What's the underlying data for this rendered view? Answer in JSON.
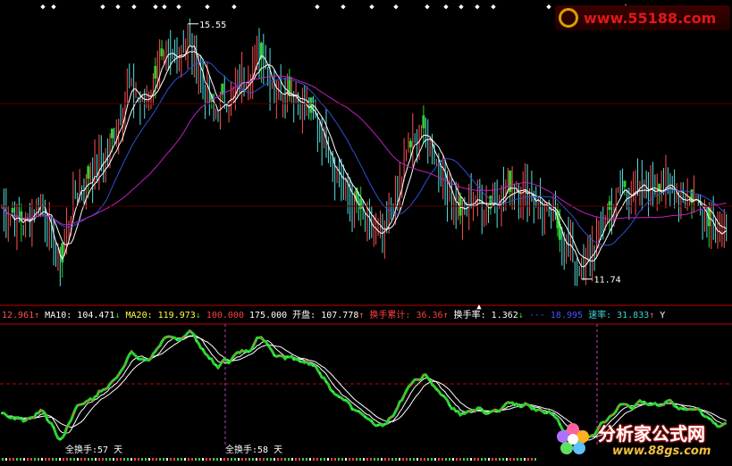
{
  "colors": {
    "background": "#000000",
    "up": "#ff5050",
    "down": "#55e0e0",
    "ma_short": "#ffffff",
    "ma10": "#ffff40",
    "ma20": "#ff40ff",
    "ma_blue": "#3050d0",
    "ma_magenta": "#c020c0",
    "highlight_green": "#30d030",
    "divider": "#c00000",
    "label_white": "#ffffff",
    "label_red": "#ff4040",
    "label_green": "#40c040",
    "label_blue": "#5050ff",
    "label_cyan": "#40d0d0"
  },
  "info_bar": [
    {
      "text": "12.961",
      "color": "#ff5050"
    },
    {
      "text": "↑",
      "color": "#ff5050"
    },
    {
      "text": " MA10: 104.471",
      "color": "#ffffff"
    },
    {
      "text": "↓",
      "color": "#40c040"
    },
    {
      "text": " MA20: 119.973",
      "color": "#ffff40"
    },
    {
      "text": "↓",
      "color": "#40c040"
    },
    {
      "text": " 100.000",
      "color": "#ff4040"
    },
    {
      "text": "  175.000",
      "color": "#ffffff"
    },
    {
      "text": "  开盘: 107.778",
      "color": "#ffffff"
    },
    {
      "text": "↑",
      "color": "#ff5050"
    },
    {
      "text": "  换手累计: 36.36",
      "color": "#ff4040"
    },
    {
      "text": "↑",
      "color": "#ff5050"
    },
    {
      "text": "  换手率: 1.362",
      "color": "#ffffff"
    },
    {
      "text": "↓",
      "color": "#40c040"
    },
    {
      "text": "  ···  18.995",
      "color": "#5050ff"
    },
    {
      "text": "  速率: 31.833",
      "color": "#40d0d0"
    },
    {
      "text": "↑",
      "color": "#ff5050"
    },
    {
      "text": " Y",
      "color": "#ffffff"
    }
  ],
  "annotations": {
    "high_label": "15.55",
    "low_label": "11.74",
    "turnover_1": "全换手:57 天",
    "turnover_2": "全换手:58 天"
  },
  "watermarks": {
    "top_url": "www.55188.com",
    "bottom_cn": "分析家公式网",
    "bottom_url": "www.88gs.com"
  },
  "chart_data": [
    {
      "type": "candlestick",
      "title": "",
      "price_high": 15.55,
      "price_low": 11.74,
      "ylim": [
        11.4,
        15.8
      ],
      "high_index": 86,
      "low_index": 268,
      "ma_series": [
        {
          "name": "",
          "color": "#ffffff",
          "period": 5
        },
        {
          "name": "",
          "color": "#ffffff",
          "period": 10
        },
        {
          "name": "",
          "color": "#3050d0",
          "period": 25
        },
        {
          "name": "",
          "color": "#c020c0",
          "period": 60
        }
      ],
      "close_keypoints": [
        [
          0,
          12.8
        ],
        [
          10,
          12.55
        ],
        [
          18,
          12.95
        ],
        [
          26,
          11.9
        ],
        [
          34,
          13.05
        ],
        [
          42,
          13.3
        ],
        [
          50,
          13.7
        ],
        [
          58,
          14.6
        ],
        [
          66,
          14.35
        ],
        [
          72,
          14.9
        ],
        [
          80,
          15.05
        ],
        [
          86,
          15.3
        ],
        [
          92,
          14.75
        ],
        [
          98,
          14.15
        ],
        [
          102,
          14.4
        ],
        [
          108,
          14.55
        ],
        [
          114,
          14.85
        ],
        [
          120,
          15.15
        ],
        [
          126,
          14.55
        ],
        [
          132,
          14.6
        ],
        [
          138,
          14.4
        ],
        [
          146,
          14.05
        ],
        [
          154,
          13.4
        ],
        [
          162,
          12.9
        ],
        [
          170,
          12.45
        ],
        [
          176,
          12.3
        ],
        [
          182,
          12.95
        ],
        [
          188,
          13.65
        ],
        [
          194,
          13.95
        ],
        [
          200,
          13.6
        ],
        [
          206,
          13.1
        ],
        [
          212,
          12.7
        ],
        [
          218,
          12.95
        ],
        [
          224,
          12.85
        ],
        [
          230,
          13.0
        ],
        [
          236,
          13.15
        ],
        [
          242,
          13.05
        ],
        [
          248,
          12.9
        ],
        [
          254,
          12.65
        ],
        [
          260,
          12.3
        ],
        [
          268,
          11.85
        ],
        [
          274,
          12.25
        ],
        [
          280,
          12.7
        ],
        [
          286,
          13.05
        ],
        [
          292,
          13.05
        ],
        [
          298,
          13.05
        ],
        [
          304,
          13.15
        ],
        [
          310,
          13.05
        ],
        [
          316,
          12.95
        ],
        [
          322,
          12.9
        ],
        [
          326,
          12.7
        ],
        [
          330,
          12.5
        ],
        [
          335,
          12.35
        ]
      ]
    },
    {
      "type": "line",
      "title": "",
      "ylim": [
        0,
        100
      ],
      "series": [
        {
          "name": "",
          "color": "#30d030"
        },
        {
          "name": "",
          "color": "#ffffff"
        },
        {
          "name": "",
          "color": "#ffffff"
        }
      ]
    }
  ]
}
